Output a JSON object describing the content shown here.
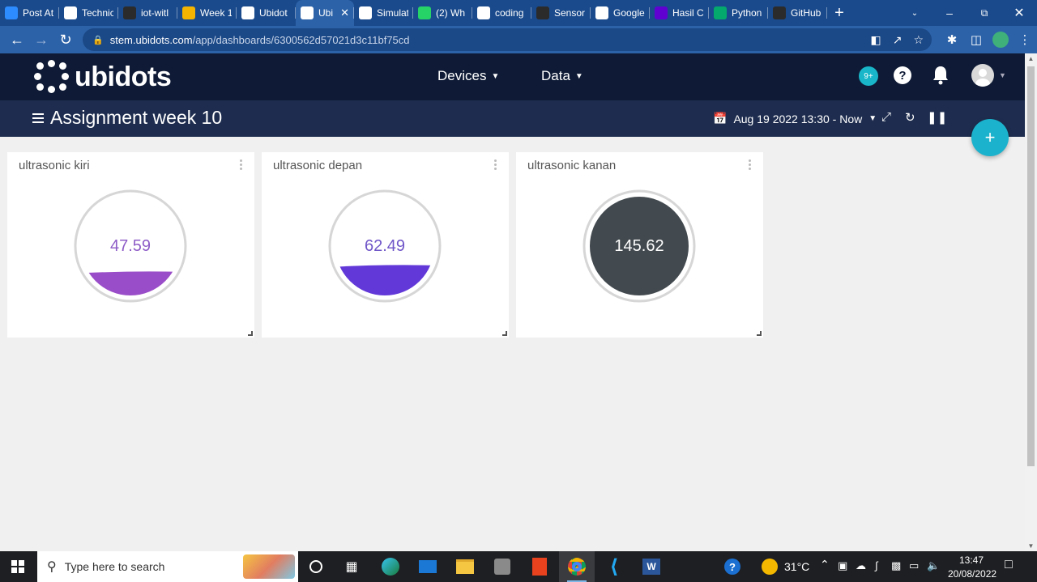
{
  "browser": {
    "tabs": [
      {
        "label": "Post At",
        "icon": "zoom-icon",
        "color": "#2d8cff"
      },
      {
        "label": "Technic",
        "icon": "classroom-icon",
        "color": "#ffffff"
      },
      {
        "label": "iot-witl",
        "icon": "github-icon",
        "color": "#2b2b2b"
      },
      {
        "label": "Week 1",
        "icon": "slides-icon",
        "color": "#f4b400"
      },
      {
        "label": "Ubidot",
        "icon": "ubidots-icon",
        "color": "#ffffff"
      },
      {
        "label": "Ubi",
        "icon": "ubidots-icon",
        "color": "#ffffff",
        "active": true
      },
      {
        "label": "Simulat",
        "icon": "grid-icon",
        "color": "#ffffff"
      },
      {
        "label": "(2) Wh",
        "icon": "whatsapp-icon",
        "color": "#25d366"
      },
      {
        "label": "coding",
        "icon": "chatgpt-icon",
        "color": "#ffffff"
      },
      {
        "label": "Sensor",
        "icon": "github-icon",
        "color": "#2b2b2b"
      },
      {
        "label": "Google",
        "icon": "google-icon",
        "color": "#ffffff"
      },
      {
        "label": "Hasil C",
        "icon": "yahoo-icon",
        "color": "#6001d2"
      },
      {
        "label": "Python",
        "icon": "w3schools-icon",
        "color": "#04aa6d"
      },
      {
        "label": "GitHub",
        "icon": "github-icon",
        "color": "#2b2b2b"
      }
    ],
    "url_host": "stem.ubidots.com",
    "url_path": "/app/dashboards/6300562d57021d3c11bf75cd"
  },
  "header": {
    "logo_text": "ubidots",
    "menu_devices": "Devices",
    "menu_data": "Data",
    "notification_count": "9+",
    "help_label": "?"
  },
  "dashboard": {
    "title": "Assignment week 10",
    "date_range": "Aug 19 2022 13:30 - Now"
  },
  "widgets": [
    {
      "title": "ultrasonic kiri",
      "value": "47.59",
      "fill_fraction": 0.25,
      "fill_color": "#9a4dc8",
      "text_color": "#8e5cc7"
    },
    {
      "title": "ultrasonic depan",
      "value": "62.49",
      "fill_fraction": 0.31,
      "fill_color": "#6238d8",
      "text_color": "#6f55c8"
    },
    {
      "title": "ultrasonic kanan",
      "value": "145.62",
      "fill_fraction": 1.0,
      "fill_color": "#434a4f",
      "text_color": "#ffffff"
    }
  ],
  "taskbar": {
    "search_placeholder": "Type here to search",
    "weather_temp": "31°C",
    "time": "13:47",
    "date": "20/08/2022"
  },
  "colors": {
    "tabstrip": "#1a4a8c",
    "header": "#0f1b36",
    "dash_bar": "#1e2d4f",
    "accent": "#1ab2cc"
  }
}
